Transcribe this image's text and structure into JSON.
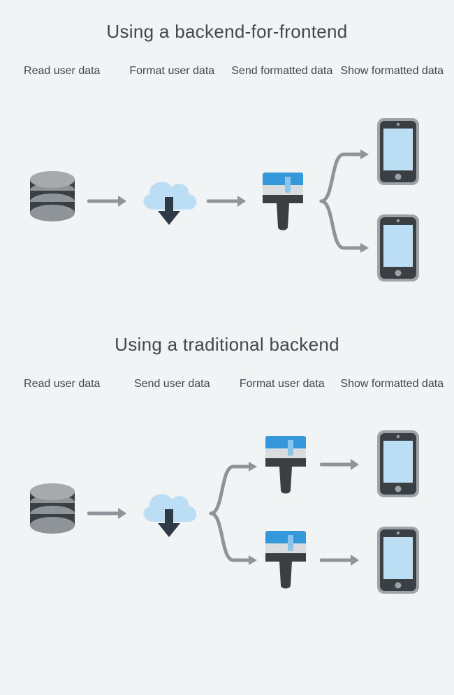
{
  "section1": {
    "title": "Using a backend-for-frontend",
    "labels": [
      "Read user data",
      "Format user data",
      "Send formatted data",
      "Show formatted data"
    ]
  },
  "section2": {
    "title": "Using a traditional backend",
    "labels": [
      "Read user data",
      "Send user data",
      "Format user data",
      "Show formatted data"
    ]
  }
}
